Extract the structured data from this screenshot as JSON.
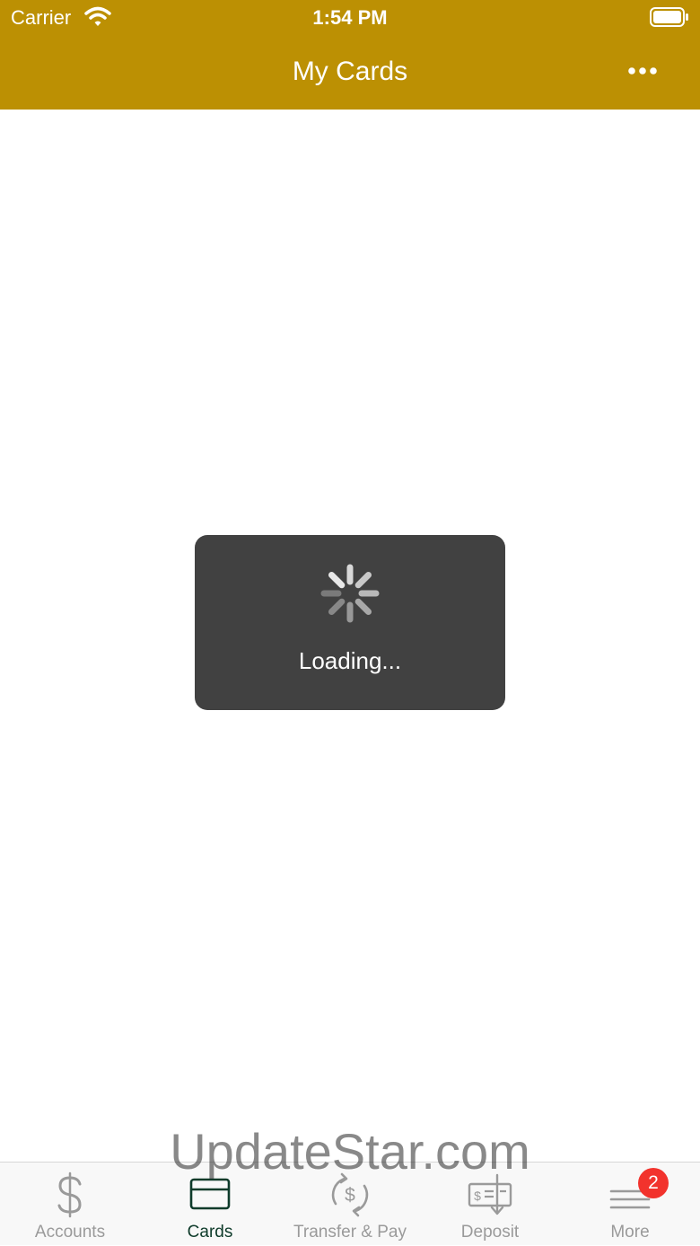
{
  "status_bar": {
    "carrier": "Carrier",
    "time": "1:54 PM"
  },
  "header": {
    "title": "My Cards",
    "more_icon": "ellipsis-icon",
    "background_color": "#BC9003"
  },
  "loading": {
    "text": "Loading...",
    "spinner_icon": "activity-spinner-icon",
    "hud_color": "#414141"
  },
  "watermark": {
    "text": "UpdateStar.com"
  },
  "tab_bar": {
    "active_color": "#0E3B2A",
    "inactive_color": "#9a9a9a",
    "tabs": [
      {
        "label": "Accounts",
        "icon": "dollar-icon",
        "active": false
      },
      {
        "label": "Cards",
        "icon": "credit-card-icon",
        "active": true
      },
      {
        "label": "Transfer & Pay",
        "icon": "transfer-dollar-icon",
        "active": false
      },
      {
        "label": "Deposit",
        "icon": "check-deposit-icon",
        "active": false
      },
      {
        "label": "More",
        "icon": "menu-lines-icon",
        "active": false,
        "badge": "2"
      }
    ]
  }
}
